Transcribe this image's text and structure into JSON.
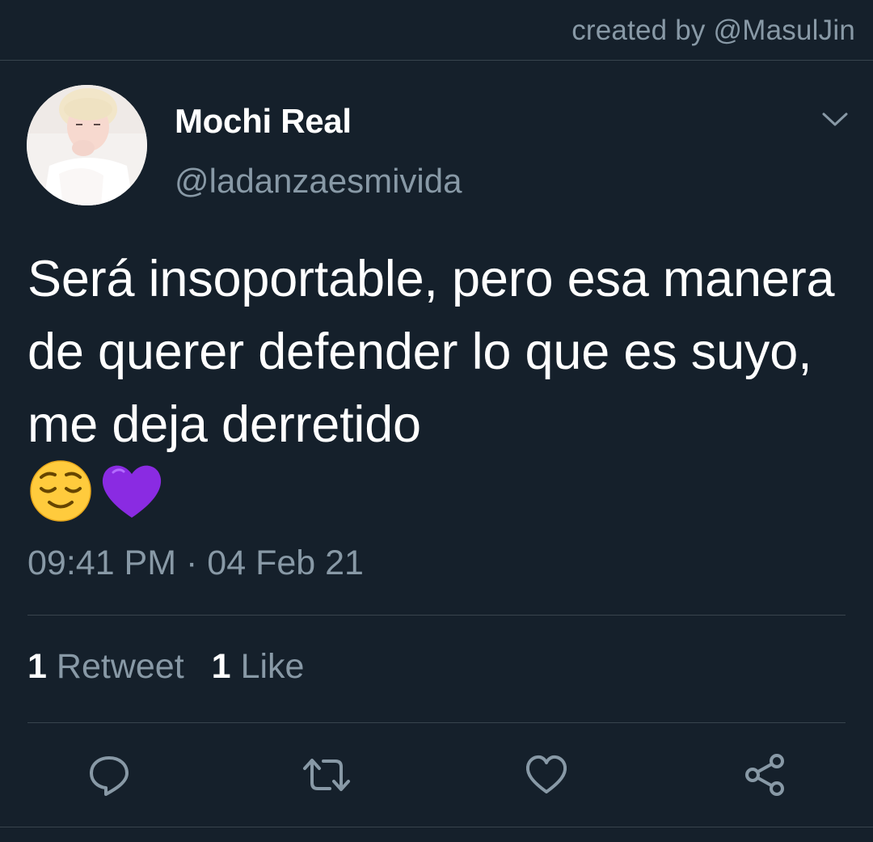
{
  "watermark": "created by @MasulJin",
  "author": {
    "display_name": "Mochi Real",
    "handle": "@ladanzaesmivida"
  },
  "tweet": {
    "text": "Será insoportable, pero esa manera de querer defender lo que es suyo, me deja derretido",
    "emojis": [
      "relieved-face",
      "purple-heart"
    ],
    "time": "09:41 PM",
    "separator": "·",
    "date": "04 Feb 21"
  },
  "stats": {
    "retweets_count": "1",
    "retweets_label": "Retweet",
    "likes_count": "1",
    "likes_label": "Like"
  },
  "actions": [
    {
      "name": "reply",
      "icon": "comment-icon"
    },
    {
      "name": "retweet",
      "icon": "retweet-icon"
    },
    {
      "name": "like",
      "icon": "heart-icon"
    },
    {
      "name": "share",
      "icon": "share-icon"
    }
  ],
  "colors": {
    "background": "#15202b",
    "secondary_text": "#8899a6",
    "divider": "#38444d",
    "emoji_heart": "#8a2be2",
    "emoji_face": "#ffcb3d"
  }
}
